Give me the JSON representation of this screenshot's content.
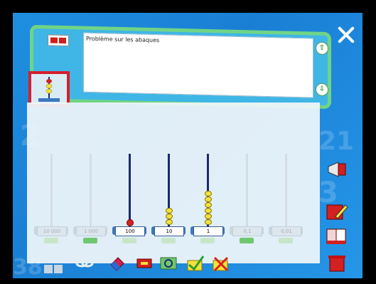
{
  "question": {
    "text": "Problème sur les abaques"
  },
  "abacus": {
    "columns": [
      {
        "label": "10 000",
        "active": false,
        "beads": 0
      },
      {
        "label": "1 000",
        "active": false,
        "beads": 0
      },
      {
        "label": "100",
        "active": true,
        "beads": 1
      },
      {
        "label": "10",
        "active": true,
        "beads": 3
      },
      {
        "label": "1",
        "active": true,
        "beads": 6
      },
      {
        "label": "0,1",
        "active": false,
        "beads": 0
      },
      {
        "label": "0,01",
        "active": false,
        "beads": 0
      }
    ]
  },
  "colors": {
    "panel_border": "#6fd486",
    "panel_fill": "#3fb6e6",
    "rod": "#1b2a6b",
    "bead_red": "#d42020",
    "bead_yellow": "#f4e13a"
  },
  "icons": {
    "panel": "stop-record-icon",
    "thumb": "abacus-thumbnail-icon",
    "close": "close-icon",
    "side": [
      "megaphone-icon",
      "pencil-icon",
      "book-icon",
      "trash-icon"
    ],
    "bottom": [
      "plus-icon",
      "minus-icon",
      "link-icon",
      "eraser-icon",
      "stop-sign-icon",
      "swap-icon",
      "check-icon",
      "cross-icon"
    ]
  }
}
